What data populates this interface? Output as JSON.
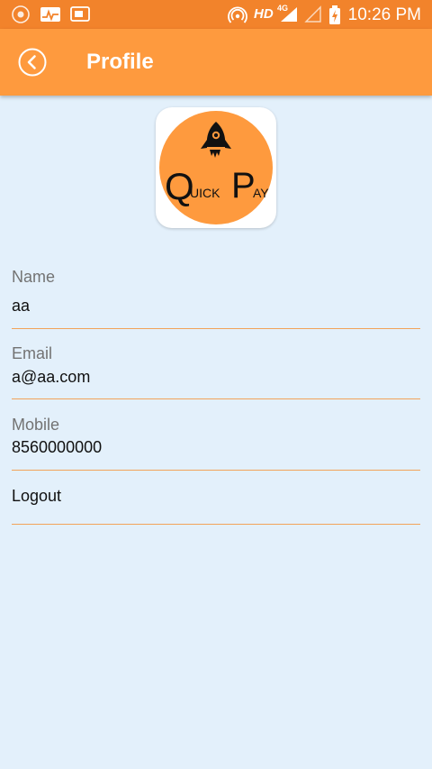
{
  "status_bar": {
    "network": "HD",
    "network_type": "4G",
    "time": "10:26 PM",
    "icons": [
      "chrome-icon",
      "activity-icon",
      "screen-cast-icon",
      "hotspot-icon",
      "signal-icon",
      "no-signal-icon",
      "battery-charging-icon"
    ]
  },
  "header": {
    "title": "Profile",
    "back_icon": "chevron-left-circle-icon"
  },
  "logo": {
    "text_q": "Q",
    "text_uick": "UICK",
    "text_p": "P",
    "text_ay": "AY",
    "icon": "rocket-icon",
    "background_color": "#fe9a3e"
  },
  "profile": {
    "name_label": "Name",
    "name_value": "aa",
    "email_label": "Email",
    "email_value": "a@aa.com",
    "mobile_label": "Mobile",
    "mobile_value": "8560000000",
    "logout_label": "Logout"
  },
  "colors": {
    "status_bar": "#f2832b",
    "app_bar": "#fe9a3e",
    "background": "#e3f0fb",
    "divider": "#f2a35a"
  }
}
